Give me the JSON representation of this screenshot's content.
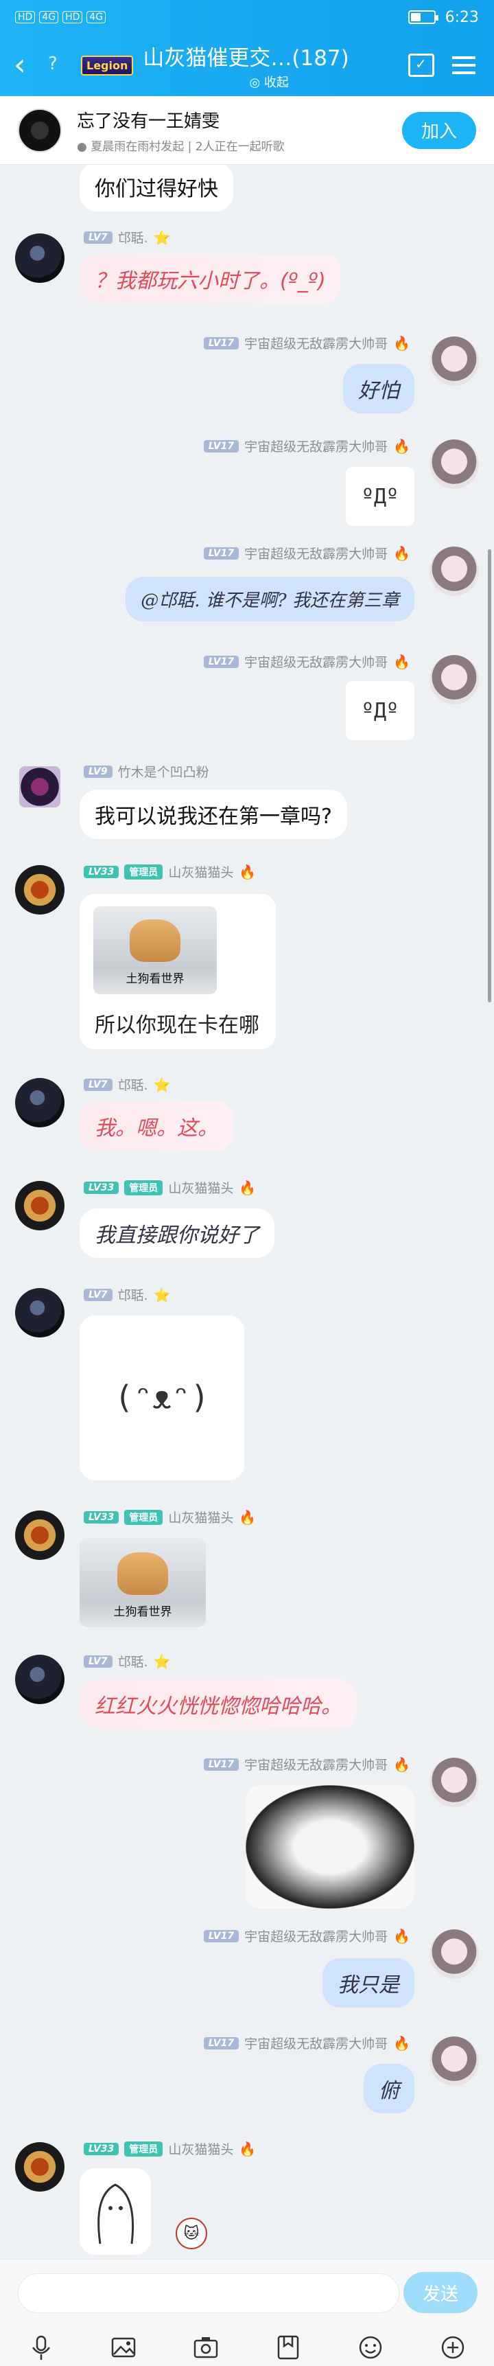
{
  "status": {
    "time": "6:23",
    "signal": [
      "HD",
      "4G",
      "HD",
      "4G"
    ]
  },
  "header": {
    "group_tag": "Legion",
    "title": "山灰猫催更交…(187)",
    "subtitle": "◎ 收起"
  },
  "banner": {
    "song": "忘了没有一王婧雯",
    "meta": "● 夏晨雨在雨村发起 | 2人正在一起听歌",
    "join": "加入"
  },
  "messages": [
    {
      "text": "你们过得好快"
    },
    {
      "name": "邙聒.",
      "lv": "LV7",
      "text": "？我都玩六小时了。(º_º)"
    },
    {
      "name": "宇宙超级无敌霹雳大帅哥",
      "lv": "LV17",
      "text": "好怕"
    },
    {
      "name": "宇宙超级无敌霹雳大帅哥",
      "lv": "LV17",
      "sticker": "ºДº"
    },
    {
      "name": "宇宙超级无敌霹雳大帅哥",
      "lv": "LV17",
      "text": "@邙聒. 谁不是啊? 我还在第三章"
    },
    {
      "name": "宇宙超级无敌霹雳大帅哥",
      "lv": "LV17",
      "sticker": "ºДº"
    },
    {
      "name": "竹木是个凹凸粉",
      "lv": "LV9",
      "text": "我可以说我还在第一章吗?"
    },
    {
      "name": "山灰猫猫头",
      "lv": "LV33",
      "role": "管理员",
      "img_caption": "土狗看世界",
      "text": "所以你现在卡在哪"
    },
    {
      "name": "邙聒.",
      "lv": "LV7",
      "text": "我。嗯。这。"
    },
    {
      "name": "山灰猫猫头",
      "lv": "LV33",
      "role": "管理员",
      "text": "我直接跟你说好了"
    },
    {
      "name": "邙聒.",
      "lv": "LV7",
      "sticker": "(ᵔᴥᵔ)"
    },
    {
      "name": "山灰猫猫头",
      "lv": "LV33",
      "role": "管理员",
      "img_caption": "土狗看世界"
    },
    {
      "name": "邙聒.",
      "lv": "LV7",
      "text": "红红火火恍恍惚惚哈哈哈。"
    },
    {
      "name": "宇宙超级无敌霹雳大帅哥",
      "lv": "LV17"
    },
    {
      "name": "宇宙超级无敌霹雳大帅哥",
      "lv": "LV17",
      "text": "我只是"
    },
    {
      "name": "宇宙超级无敌霹雳大帅哥",
      "lv": "LV17",
      "text": "俯"
    },
    {
      "name": "山灰猫猫头",
      "lv": "LV33",
      "role": "管理员"
    }
  ],
  "input": {
    "placeholder": "",
    "send": "发送"
  },
  "icons": [
    "back-icon",
    "help-icon",
    "calendar-check-icon",
    "menu-icon",
    "mic-icon",
    "image-icon",
    "camera-icon",
    "bookmark-icon",
    "emoji-icon",
    "plus-icon"
  ],
  "colors": {
    "header": "#1fb4f5",
    "join": "#1cb4f4",
    "admin": "#3ec3b0",
    "pink_text": "#e04b5a"
  }
}
